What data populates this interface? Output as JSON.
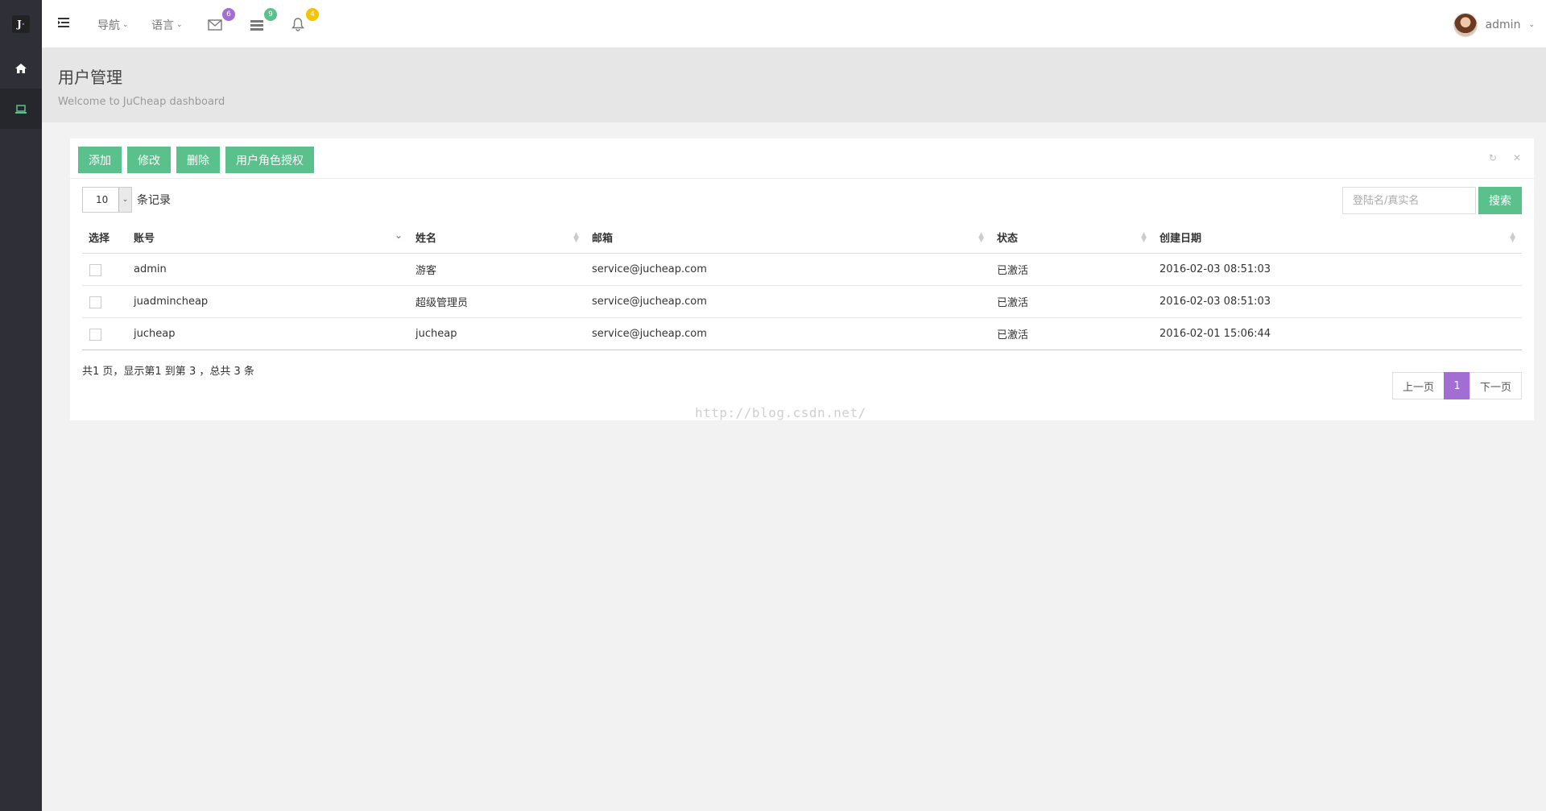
{
  "brand": {
    "logo_letter": "J"
  },
  "topbar": {
    "menus": [
      {
        "label": "导航"
      },
      {
        "label": "语言"
      }
    ],
    "badges": {
      "mail": "6",
      "tasks": "9",
      "alerts": "4"
    },
    "badge_colors": {
      "mail": "#a26ed3",
      "tasks": "#5bc18c",
      "alerts": "#f5c200"
    },
    "user_name": "admin"
  },
  "sidebar": {
    "items": [
      {
        "icon": "home-icon",
        "active": false
      },
      {
        "icon": "laptop-icon",
        "active": true
      }
    ]
  },
  "page": {
    "title": "用户管理",
    "subtitle": "Welcome to JuCheap dashboard"
  },
  "toolbar": {
    "add_label": "添加",
    "edit_label": "修改",
    "delete_label": "删除",
    "roles_label": "用户角色授权"
  },
  "table_controls": {
    "page_length": "10",
    "page_length_suffix": "条记录",
    "search_placeholder": "登陆名/真实名",
    "search_button": "搜索"
  },
  "table": {
    "headers": [
      "选择",
      "账号",
      "姓名",
      "邮箱",
      "状态",
      "创建日期"
    ],
    "rows": [
      {
        "account": "admin",
        "name": "游客",
        "email": "service@jucheap.com",
        "status": "已激活",
        "created": "2016-02-03 08:51:03"
      },
      {
        "account": "juadmincheap",
        "name": "超级管理员",
        "email": "service@jucheap.com",
        "status": "已激活",
        "created": "2016-02-03 08:51:03"
      },
      {
        "account": "jucheap",
        "name": "jucheap",
        "email": "service@jucheap.com",
        "status": "已激活",
        "created": "2016-02-01 15:06:44"
      }
    ]
  },
  "footer": {
    "info": "共1 页，显示第1 到第 3 ，总共 3 条",
    "prev": "上一页",
    "current": "1",
    "next": "下一页"
  },
  "watermark": "http://blog.csdn.net/",
  "colors": {
    "accent_green": "#5bc18c",
    "accent_purple": "#a26ed3",
    "sidebar_bg": "#2f3037"
  }
}
